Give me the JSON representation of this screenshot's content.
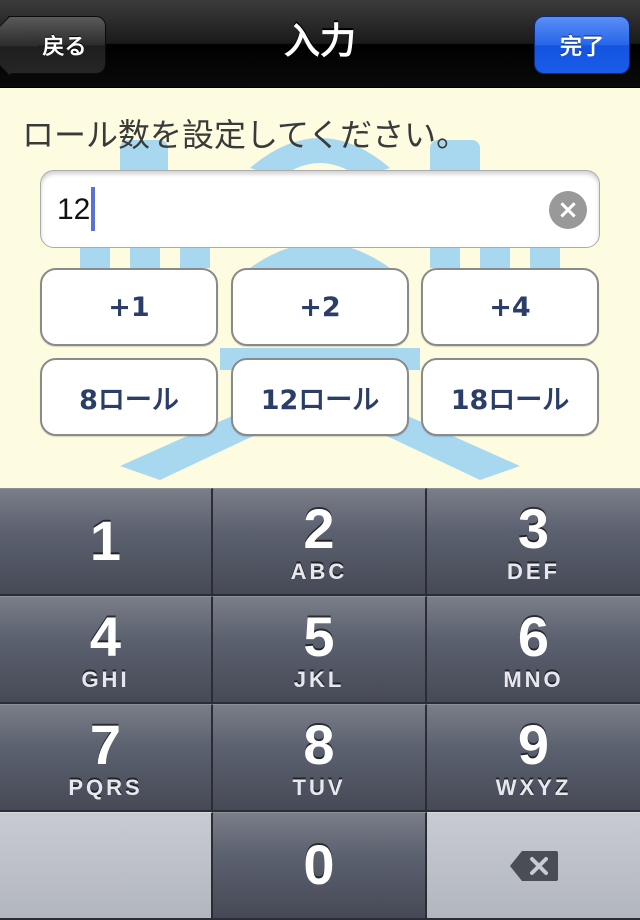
{
  "nav": {
    "back_label": "戻る",
    "title": "入力",
    "done_label": "完了"
  },
  "content": {
    "prompt": "ロール数を設定してください。",
    "field_value": "12",
    "clear_icon": "clear-icon",
    "quick_buttons": [
      "+1",
      "+2",
      "+4",
      "8ロール",
      "12ロール",
      "18ロール"
    ]
  },
  "keypad": {
    "keys": [
      {
        "digit": "1",
        "letters": ""
      },
      {
        "digit": "2",
        "letters": "ABC"
      },
      {
        "digit": "3",
        "letters": "DEF"
      },
      {
        "digit": "4",
        "letters": "GHI"
      },
      {
        "digit": "5",
        "letters": "JKL"
      },
      {
        "digit": "6",
        "letters": "MNO"
      },
      {
        "digit": "7",
        "letters": "PQRS"
      },
      {
        "digit": "8",
        "letters": "TUV"
      },
      {
        "digit": "9",
        "letters": "WXYZ"
      },
      {
        "digit": "0",
        "letters": ""
      }
    ],
    "delete_icon": "backspace-icon"
  },
  "colors": {
    "background": "#fdfbe0",
    "art": "#a8d8f0",
    "done_blue": "#2566e8",
    "button_text": "#2a3e68"
  }
}
